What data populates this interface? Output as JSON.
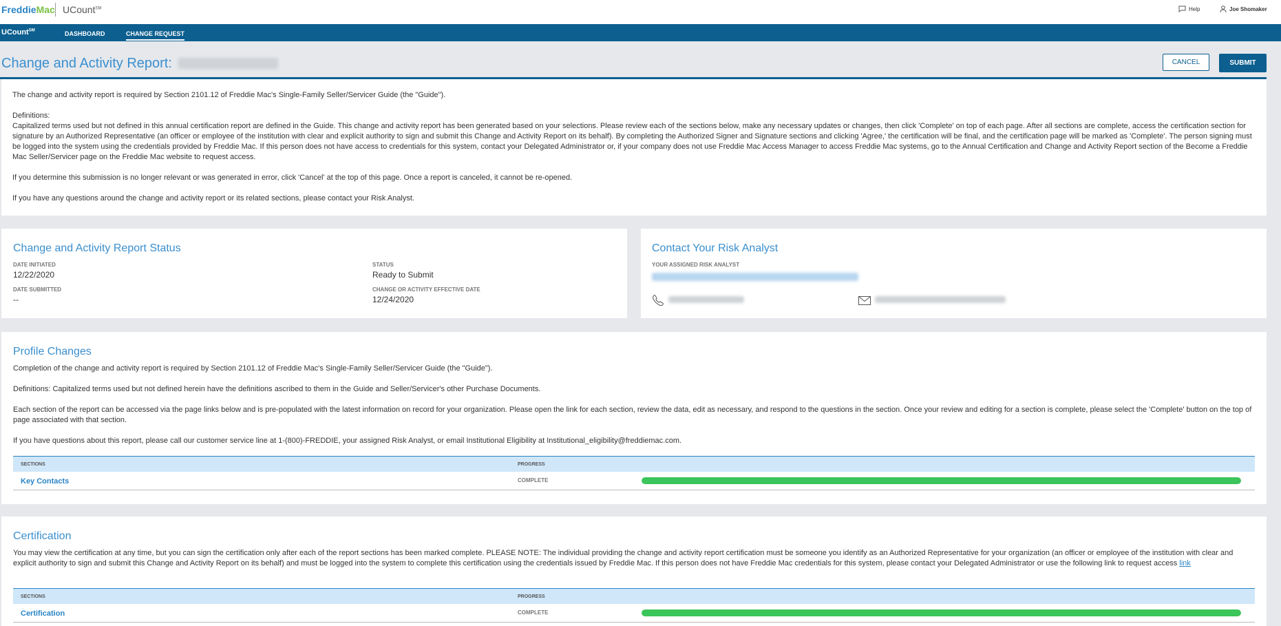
{
  "topbar": {
    "logo_part1": "Freddie",
    "logo_part2": "Mac",
    "app_name": "UCount",
    "app_sup": "SM",
    "help_label": "Help",
    "user_name": "Joe Shomaker"
  },
  "nav": {
    "brand": "UCount",
    "brand_sup": "SM",
    "items": [
      {
        "label": "DASHBOARD"
      },
      {
        "label": "CHANGE REQUEST"
      }
    ]
  },
  "header": {
    "title": "Change and Activity Report:",
    "cancel_label": "CANCEL",
    "submit_label": "SUBMIT"
  },
  "intro": {
    "p1": "The change and activity report is required by Section 2101.12 of Freddie Mac's Single-Family Seller/Servicer Guide (the \"Guide\").",
    "p2_title": "Definitions:",
    "p2_body": "Capitalized terms used but not defined in this annual certification report are defined in the Guide. This change and activity report has been generated based on your selections. Please review each of the sections below, make any necessary updates or changes, then click 'Complete' on top of each page. After all sections are complete, access the certification section for signature by an Authorized Representative (an officer or employee of the institution with clear and explicit authority to sign and submit this Change and Activity Report on its behalf). By completing the Authorized Signer and Signature sections and clicking 'Agree,' the certification will be final, and the certification page will be marked as 'Complete'. The person signing must be logged into the system using the credentials provided by Freddie Mac. If this person does not have access to credentials for this system, contact your Delegated Administrator or, if your company does not use Freddie Mac Access Manager to access Freddie Mac systems, go to the Annual Certification and Change and Activity Report section of the Become a Freddie Mac Seller/Servicer page on the Freddie Mac website to request access.",
    "p3": "If you determine this submission is no longer relevant or was generated in error, click 'Cancel' at the top of this page. Once a report is canceled, it cannot be re-opened.",
    "p4": "If you have any questions around the change and activity report or its related sections, please contact your Risk Analyst."
  },
  "status": {
    "title": "Change and Activity Report Status",
    "date_initiated_label": "DATE INITIATED",
    "date_initiated": "12/22/2020",
    "status_label": "STATUS",
    "status": "Ready to Submit",
    "date_submitted_label": "DATE SUBMITTED",
    "date_submitted": "--",
    "effective_date_label": "CHANGE OR ACTIVITY EFFECTIVE DATE",
    "effective_date": "12/24/2020"
  },
  "analyst": {
    "title": "Contact Your Risk Analyst",
    "assigned_label": "YOUR ASSIGNED RISK ANALYST"
  },
  "profile": {
    "title": "Profile Changes",
    "p1": "Completion of the change and activity report is required by Section 2101.12 of Freddie Mac's Single-Family Seller/Servicer Guide (the \"Guide\").",
    "p2": "Definitions: Capitalized terms used but not defined herein have the definitions ascribed to them in the Guide and Seller/Servicer's other Purchase Documents.",
    "p3": "Each section of the report can be accessed via the page links below and is pre-populated with the latest information on record for your organization. Please open the link for each section, review the data, edit as necessary, and respond to the questions in the section. Once your review and editing for a section is complete, please select the 'Complete' button on the top of page associated with that section.",
    "p4": "If you have questions about this report, please call our customer service line at 1-(800)-FREDDIE, your assigned Risk Analyst, or email Institutional Eligibility at Institutional_eligibility@freddiemac.com.",
    "sections_header": "SECTIONS",
    "progress_header": "PROGRESS",
    "rows": [
      {
        "section": "Key Contacts",
        "status": "COMPLETE",
        "progress": 100
      }
    ]
  },
  "certification": {
    "title": "Certification",
    "body": "You may view the certification at any time, but you can sign the certification only after each of the report sections has been marked complete. PLEASE NOTE: The individual providing the change and activity report certification must be someone you identify as an Authorized Representative for your organization (an officer or employee of the institution with clear and explicit authority to sign and submit this Change and Activity Report on its behalf) and must be logged into the system to complete this certification using the credentials issued by Freddie Mac. If this person does not have Freddie Mac credentials for this system, please contact your Delegated Administrator or use the following link to request access",
    "link_label": "link",
    "sections_header": "SECTIONS",
    "progress_header": "PROGRESS",
    "rows": [
      {
        "section": "Certification",
        "status": "COMPLETE",
        "progress": 100
      }
    ]
  },
  "colors": {
    "brand_blue": "#0c5f8f",
    "accent_blue": "#3a8fcf",
    "progress_green": "#3cc55a"
  }
}
